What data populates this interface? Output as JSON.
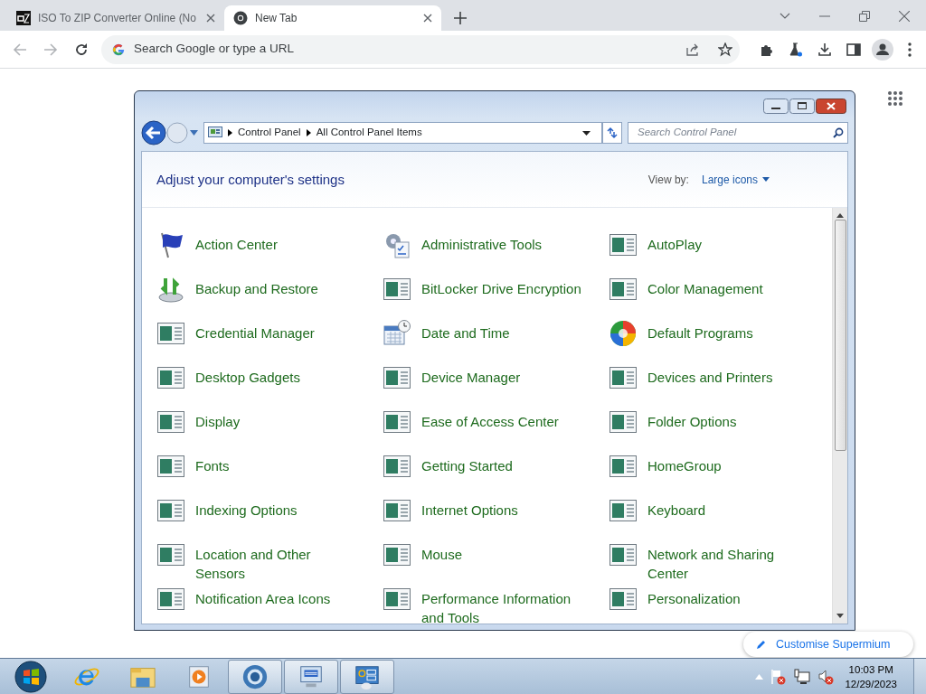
{
  "browser": {
    "tabs": [
      {
        "title": "ISO To ZIP Converter Online (No",
        "kind": "site",
        "selected": false
      },
      {
        "title": "New Tab",
        "kind": "newtab",
        "selected": true
      }
    ],
    "omnibox": {
      "placeholder": "Search Google or type a URL"
    },
    "customise_button": "Customise Supermium"
  },
  "window": {
    "breadcrumb": [
      "Control Panel",
      "All Control Panel Items"
    ],
    "search": {
      "placeholder": "Search Control Panel"
    },
    "heading": "Adjust your computer's settings",
    "view_by_label": "View by:",
    "view_by_value": "Large icons",
    "items": [
      {
        "label": "Action Center",
        "kind": "flag"
      },
      {
        "label": "Administrative Tools",
        "kind": "tools"
      },
      {
        "label": "AutoPlay",
        "kind": "generic"
      },
      {
        "label": "Backup and Restore",
        "kind": "backup"
      },
      {
        "label": "BitLocker Drive Encryption",
        "kind": "generic"
      },
      {
        "label": "Color Management",
        "kind": "generic"
      },
      {
        "label": "Credential Manager",
        "kind": "generic"
      },
      {
        "label": "Date and Time",
        "kind": "calendar"
      },
      {
        "label": "Default Programs",
        "kind": "globe"
      },
      {
        "label": "Desktop Gadgets",
        "kind": "generic"
      },
      {
        "label": "Device Manager",
        "kind": "generic"
      },
      {
        "label": "Devices and Printers",
        "kind": "generic"
      },
      {
        "label": "Display",
        "kind": "generic"
      },
      {
        "label": "Ease of Access Center",
        "kind": "generic"
      },
      {
        "label": "Folder Options",
        "kind": "generic"
      },
      {
        "label": "Fonts",
        "kind": "generic"
      },
      {
        "label": "Getting Started",
        "kind": "generic"
      },
      {
        "label": "HomeGroup",
        "kind": "generic"
      },
      {
        "label": "Indexing Options",
        "kind": "generic"
      },
      {
        "label": "Internet Options",
        "kind": "generic"
      },
      {
        "label": "Keyboard",
        "kind": "generic"
      },
      {
        "label": "Location and Other Sensors",
        "kind": "generic"
      },
      {
        "label": "Mouse",
        "kind": "generic"
      },
      {
        "label": "Network and Sharing Center",
        "kind": "generic"
      },
      {
        "label": "Notification Area Icons",
        "kind": "generic"
      },
      {
        "label": "Performance Information and Tools",
        "kind": "generic"
      },
      {
        "label": "Personalization",
        "kind": "generic"
      }
    ]
  },
  "taskbar": {
    "apps": [
      {
        "kind": "ie",
        "running": false
      },
      {
        "kind": "explorer",
        "running": false
      },
      {
        "kind": "media",
        "running": false
      },
      {
        "kind": "browser",
        "running": true
      },
      {
        "kind": "keyboard",
        "running": true
      },
      {
        "kind": "controlpanel",
        "running": true
      }
    ],
    "clock": {
      "time": "10:03 PM",
      "date": "12/29/2023"
    }
  }
}
